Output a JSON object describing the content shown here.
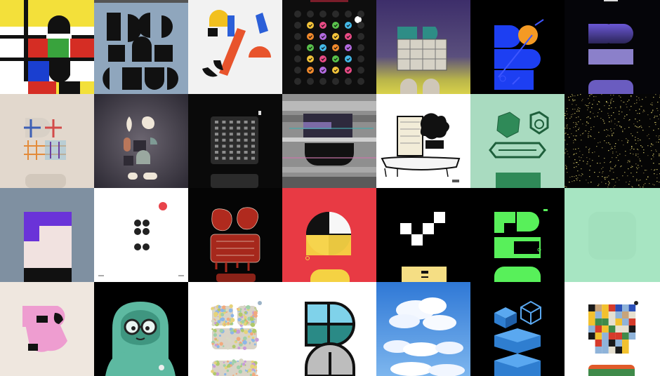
{
  "gallery": {
    "rows": 4,
    "cols": 7,
    "tiles": [
      {
        "name": "tile-mondrian-b",
        "bg": "#f3e03a"
      },
      {
        "name": "tile-gray-blue-glyphs",
        "bg": "#8fa6bd"
      },
      {
        "name": "tile-colored-shapes",
        "bg": "#f2f2f2"
      },
      {
        "name": "tile-checkmark-dots",
        "bg": "#0e0e0e"
      },
      {
        "name": "tile-purple-gradient-b",
        "bg": "#3b3461"
      },
      {
        "name": "tile-blue-b-orange-ball",
        "bg": "#000000"
      },
      {
        "name": "tile-purple-grain-b",
        "bg": "#050509"
      },
      {
        "name": "tile-cross-stitch-b",
        "bg": "#e2d8cd"
      },
      {
        "name": "tile-dusky-glyphs",
        "bg": "#5f5a64"
      },
      {
        "name": "tile-keypad-grid",
        "bg": "#0a0a0a"
      },
      {
        "name": "tile-glitch-b",
        "bg": "#8a8a8a"
      },
      {
        "name": "tile-ink-sketch",
        "bg": "#ffffff"
      },
      {
        "name": "tile-green-polyhedra",
        "bg": "#a9dbc0"
      },
      {
        "name": "tile-static-noise",
        "bg": "#050505"
      },
      {
        "name": "tile-slate-purple-block",
        "bg": "#7f90a1"
      },
      {
        "name": "tile-four-dots",
        "bg": "#ffffff"
      },
      {
        "name": "tile-red-ornate-b",
        "bg": "#050505"
      },
      {
        "name": "tile-red-circle-quadrants",
        "bg": "#e83a44"
      },
      {
        "name": "tile-pixel-checker",
        "bg": "#000000"
      },
      {
        "name": "tile-green-neon-b",
        "bg": "#000000"
      },
      {
        "name": "tile-mint-blank",
        "bg": "#a7e5c2"
      },
      {
        "name": "tile-pink-blob",
        "bg": "#efe7df"
      },
      {
        "name": "tile-green-sloth",
        "bg": "#000000"
      },
      {
        "name": "tile-mosaic-b",
        "bg": "#ffffff"
      },
      {
        "name": "tile-teal-stained-glass",
        "bg": "#ffffff"
      },
      {
        "name": "tile-sky-clouds",
        "bg": "#4c8ee0"
      },
      {
        "name": "tile-isometric-blue-cubes",
        "bg": "#000000"
      },
      {
        "name": "tile-pixel-quilt",
        "bg": "#ffffff"
      }
    ]
  }
}
